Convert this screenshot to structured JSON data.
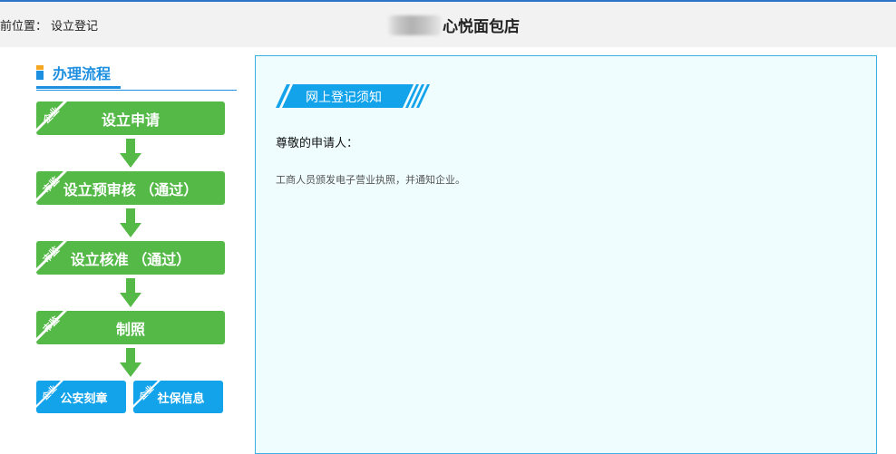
{
  "header": {
    "breadcrumb_label": "前位置：",
    "breadcrumb_current": "设立登记",
    "company_name": "心悦面包店"
  },
  "sidebar": {
    "title": "办理流程",
    "steps": [
      {
        "label": "设立申请",
        "tag": "企业"
      },
      {
        "label": "设立预审核 （通过）",
        "tag": "市监"
      },
      {
        "label": "设立核准 （通过）",
        "tag": "市监"
      },
      {
        "label": "制照",
        "tag": "市监"
      }
    ],
    "sub_steps": [
      {
        "label": "公安刻章",
        "tag": "企业"
      },
      {
        "label": "社保信息",
        "tag": "企业"
      }
    ]
  },
  "notice": {
    "title": "网上登记须知",
    "greeting": "尊敬的申请人：",
    "body": "工商人员颁发电子营业执照，并通知企业。"
  },
  "colors": {
    "accent_blue": "#1d8fe0",
    "step_green": "#54b947",
    "sub_step_blue": "#13a3ea",
    "panel_bg": "#effdfe"
  }
}
